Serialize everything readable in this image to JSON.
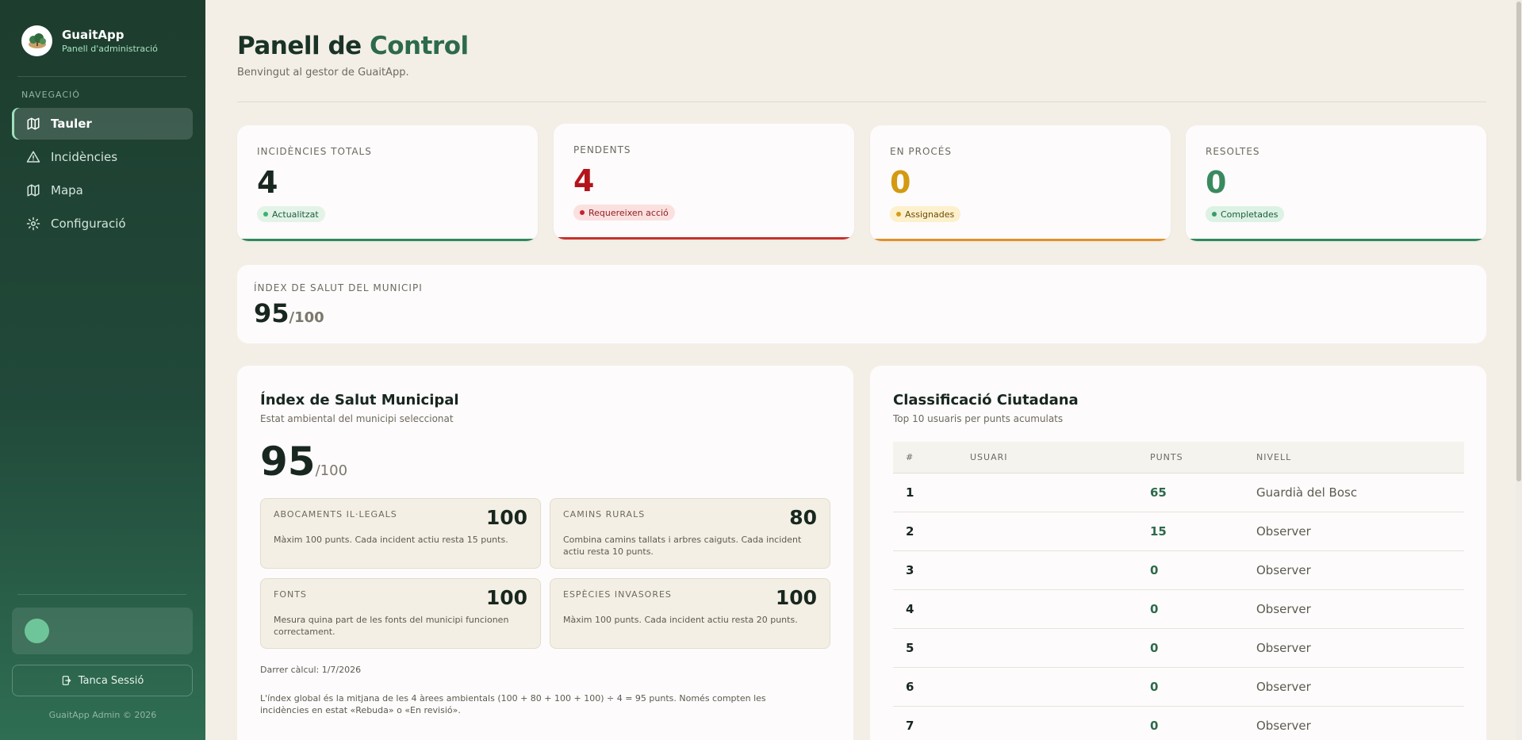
{
  "sidebar": {
    "app_name": "GuaitApp",
    "app_subtitle": "Panell d'administració",
    "nav_heading": "NAVEGACIÓ",
    "items": [
      {
        "label": "Tauler",
        "icon": "map-icon",
        "active": true
      },
      {
        "label": "Incidències",
        "icon": "warning-icon",
        "active": false
      },
      {
        "label": "Mapa",
        "icon": "map-icon",
        "active": false
      },
      {
        "label": "Configuració",
        "icon": "gear-icon",
        "active": false
      }
    ],
    "logout_label": "Tanca Sessió",
    "footer": "GuaitApp Admin © 2026"
  },
  "header": {
    "title_part1": "Panell de",
    "title_part2": "Control",
    "subtitle": "Benvingut al gestor de GuaitApp."
  },
  "stats": [
    {
      "label": "INCIDÈNCIES TOTALS",
      "value": "4",
      "badge": "Actualitzat",
      "value_color": "#18271f",
      "badge_bg": "#e3f3e8",
      "badge_color": "#1f5b3d",
      "dot_color": "#3bb270",
      "bar_color": "#2f8a5b"
    },
    {
      "label": "PENDENTS",
      "value": "4",
      "badge": "Requereixen acció",
      "value_color": "#b3141c",
      "badge_bg": "#fbe0e0",
      "badge_color": "#8e1d1d",
      "dot_color": "#c7202a",
      "bar_color": "#c9302b"
    },
    {
      "label": "EN PROCÉS",
      "value": "0",
      "badge": "Assignades",
      "value_color": "#d39a12",
      "badge_bg": "#fdf0cc",
      "badge_color": "#6b4b05",
      "dot_color": "#d79b1c",
      "bar_color": "#e0902b"
    },
    {
      "label": "RESOLTES",
      "value": "0",
      "badge": "Completades",
      "value_color": "#3a8a5f",
      "badge_bg": "#dcf2e4",
      "badge_color": "#1f5b3d",
      "dot_color": "#3b9a68",
      "bar_color": "#2f8a5b"
    }
  ],
  "health_strip": {
    "label": "ÍNDEX DE SALUT DEL MUNICIPI",
    "value": "95",
    "max": "/100"
  },
  "health_panel": {
    "title": "Índex de Salut Municipal",
    "subtitle": "Estat ambiental del municipi seleccionat",
    "score": "95",
    "max": "/100",
    "areas": [
      {
        "label": "ABOCAMENTS IL·LEGALS",
        "value": "100",
        "desc": "Màxim 100 punts. Cada incident actiu resta 15 punts."
      },
      {
        "label": "CAMINS RURALS",
        "value": "80",
        "desc": "Combina camins tallats i arbres caiguts. Cada incident actiu resta 10 punts."
      },
      {
        "label": "FONTS",
        "value": "100",
        "desc": "Mesura quina part de les fonts del municipi funcionen correctament."
      },
      {
        "label": "ESPÈCIES INVASORES",
        "value": "100",
        "desc": "Màxim 100 punts. Cada incident actiu resta 20 punts."
      }
    ],
    "last_calc": "Darrer càlcul: 1/7/2026",
    "note": "L'índex global és la mitjana de les 4 àrees ambientals (100 + 80 + 100 + 100) ÷ 4 = 95 punts. Només compten les incidències en estat «Rebuda» o «En revisió»."
  },
  "ranking": {
    "title": "Classificació Ciutadana",
    "subtitle": "Top 10 usuaris per punts acumulats",
    "columns": [
      "#",
      "USUARI",
      "PUNTS",
      "NIVELL"
    ],
    "rows": [
      {
        "rank": "1",
        "user": "",
        "points": "65",
        "level": "Guardià del Bosc"
      },
      {
        "rank": "2",
        "user": "",
        "points": "15",
        "level": "Observer"
      },
      {
        "rank": "3",
        "user": "",
        "points": "0",
        "level": "Observer"
      },
      {
        "rank": "4",
        "user": "",
        "points": "0",
        "level": "Observer"
      },
      {
        "rank": "5",
        "user": "",
        "points": "0",
        "level": "Observer"
      },
      {
        "rank": "6",
        "user": "",
        "points": "0",
        "level": "Observer"
      },
      {
        "rank": "7",
        "user": "",
        "points": "0",
        "level": "Observer"
      }
    ]
  }
}
